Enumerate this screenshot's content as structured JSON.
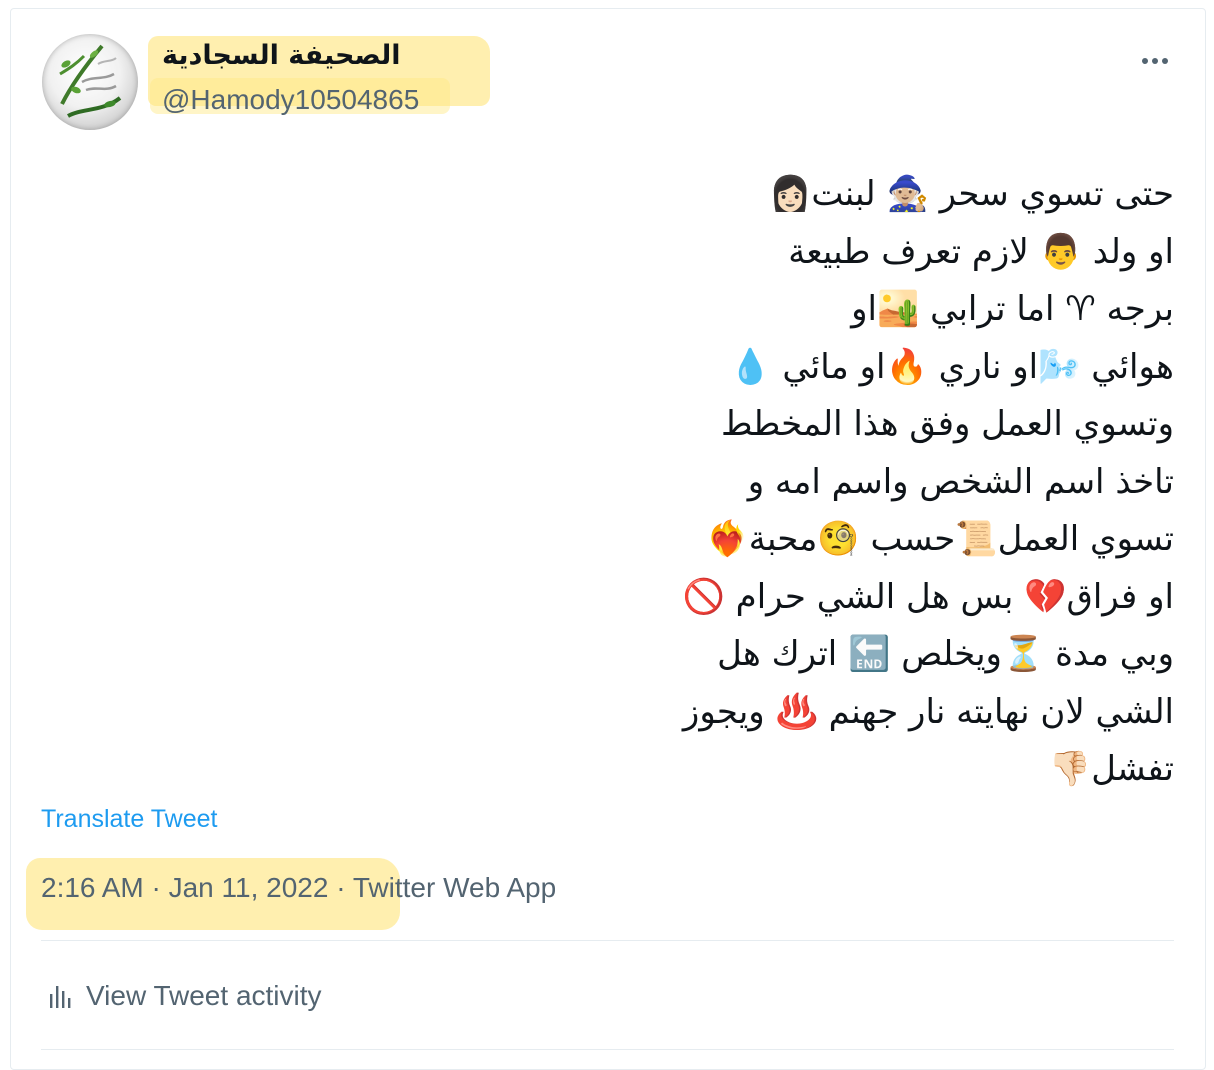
{
  "tweet": {
    "author": {
      "display_name": "الصحيفة السجادية",
      "handle": "@Hamody10504865"
    },
    "more_icon": "more-horizontal-icon",
    "text_lines": [
      "حتى تسوي سحر 🧙🏼 لبنت👩🏻",
      "او ولد 👨 لازم تعرف طبيعة",
      "برجه ♈ اما ترابي 🏜️او",
      "هوائي 🌬️او ناري 🔥او مائي 💧",
      "وتسوي العمل وفق هذا المخطط",
      "تاخذ اسم الشخص واسم امه و",
      "تسوي العمل📜حسب 🧐محبة❤️‍🔥",
      "او فراق💔 بس هل الشي حرام 🚫",
      "وبي مدة ⏳ويخلص 🔚 اترك هل",
      "الشي لان نهايته نار جهنم ♨️ ويجوز",
      "تفشل👎🏻"
    ],
    "translate_label": "Translate Tweet",
    "timestamp": "2:16 AM · Jan 11, 2022",
    "separator": " · ",
    "source": "Twitter Web App",
    "activity_label": "View Tweet activity",
    "activity_icon": "bar-chart-icon"
  },
  "colors": {
    "text": "#0f1419",
    "secondary": "#536471",
    "link": "#1d9bf0",
    "highlight": "#ffe26e",
    "border": "#e6ecf0"
  }
}
